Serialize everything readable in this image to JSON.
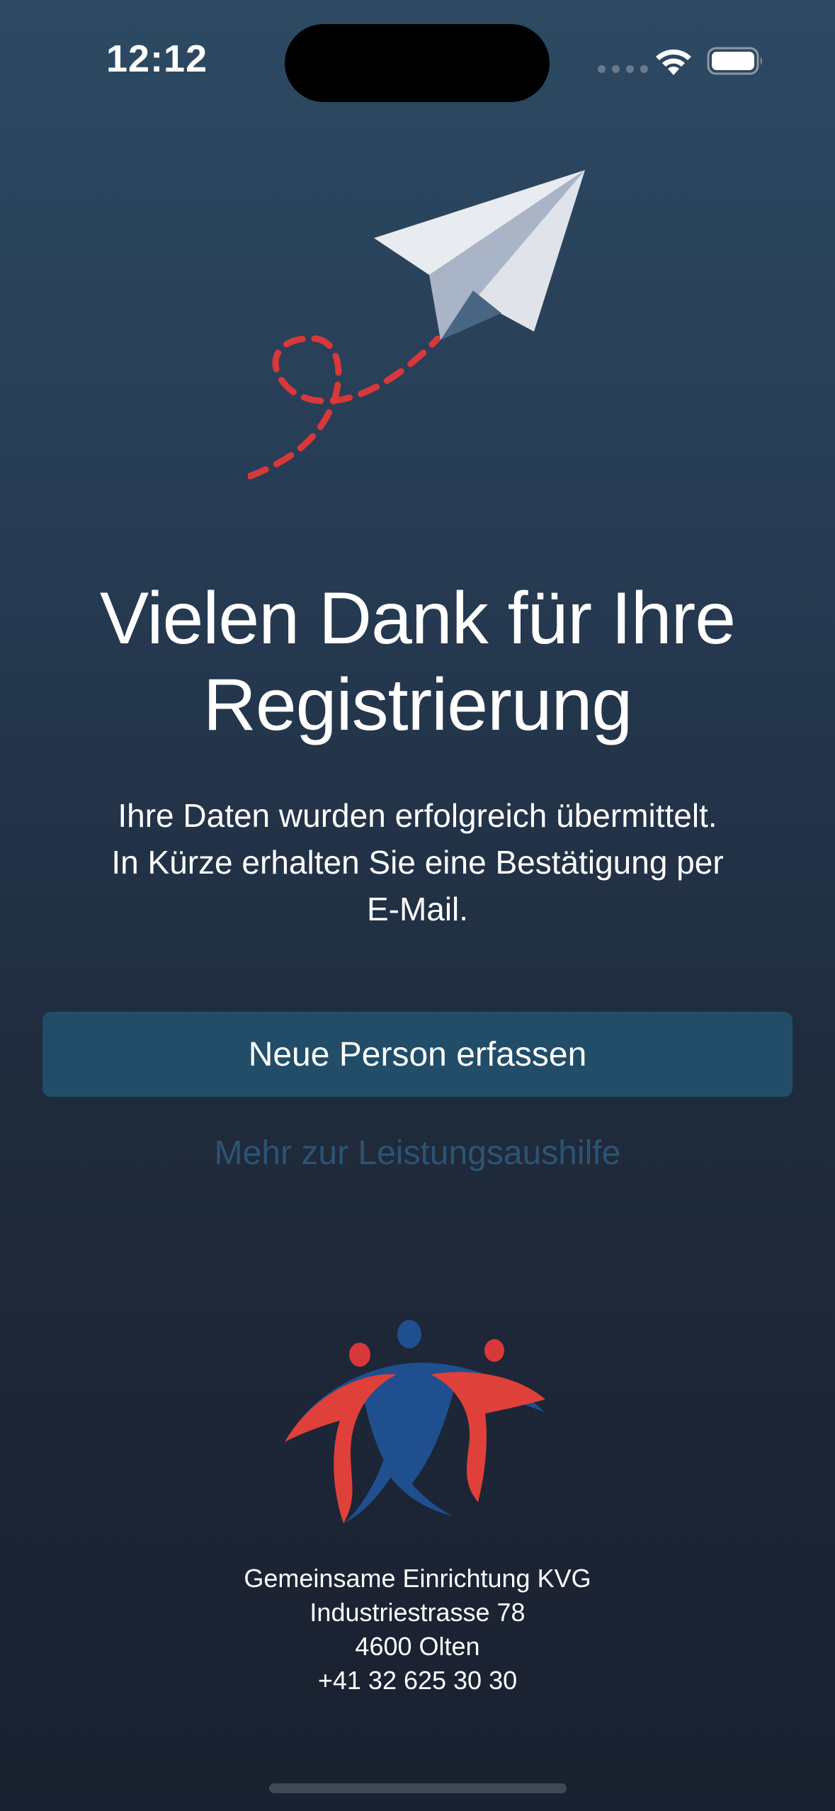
{
  "status_bar": {
    "time": "12:12"
  },
  "hero": {
    "title_line1": "Vielen Dank für Ihre",
    "title_line2": "Registrierung",
    "message_line1": "Ihre Daten wurden erfolgreich übermittelt.",
    "message_line2": "In Kürze erhalten Sie eine Bestätigung per",
    "message_line3": "E-Mail."
  },
  "actions": {
    "new_person_label": "Neue Person erfassen",
    "more_info_label": "Mehr zur Leistungsaushilfe"
  },
  "footer": {
    "org_name": "Gemeinsame Einrichtung KVG",
    "street": "Industriestrasse 78",
    "city": "4600 Olten",
    "phone": "+41 32 625 30 30"
  },
  "colors": {
    "background_top": "#2d4a63",
    "background_bottom": "#1a2130",
    "button": "#214d68",
    "link": "#2c5473",
    "logo_red": "#e0403a",
    "logo_blue": "#1f4f8f"
  }
}
